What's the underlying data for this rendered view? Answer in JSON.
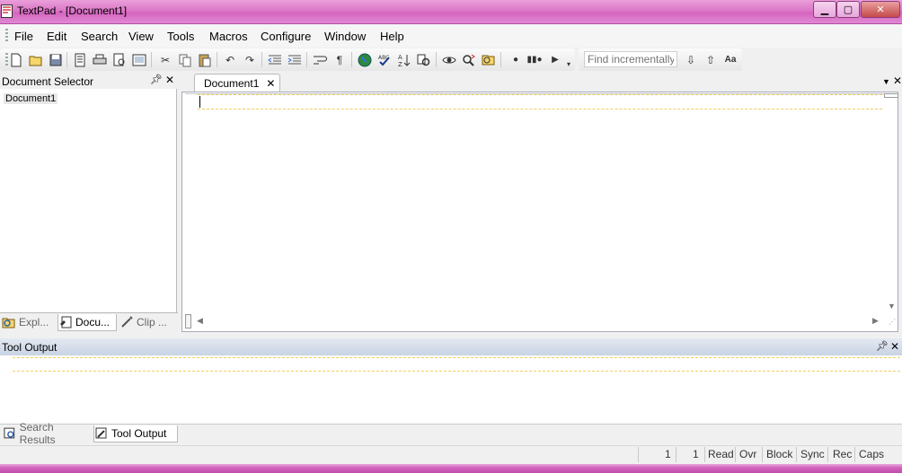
{
  "window": {
    "title": "TextPad - [Document1]",
    "accent_color": "#dc77c8",
    "caption_buttons": [
      "minimize-icon",
      "maximize-icon",
      "close-icon"
    ]
  },
  "menubar": {
    "items": [
      "File",
      "Edit",
      "Search",
      "View",
      "Tools",
      "Macros",
      "Configure",
      "Window",
      "Help"
    ]
  },
  "toolbar": {
    "icons": [
      "new-document-icon",
      "open-folder-icon",
      "save-icon",
      "save-all-icon",
      "print-icon",
      "print-preview-icon",
      "document-properties-icon",
      "cut-icon",
      "copy-icon",
      "paste-icon",
      "undo-icon",
      "redo-icon",
      "decrease-indent-icon",
      "increase-indent-icon",
      "word-wrap-icon",
      "paragraph-marks-icon",
      "browser-globe-icon",
      "spell-check-icon",
      "sort-icon",
      "compare-files-icon",
      "find-icon",
      "replace-icon",
      "find-in-files-icon",
      "record-macro-icon",
      "pause-macro-icon",
      "play-macro-icon"
    ],
    "find": {
      "placeholder": "Find incrementally",
      "down_icon": "arrow-down-icon",
      "up_icon": "arrow-up-icon",
      "case_label": "Aa"
    }
  },
  "document_selector": {
    "title": "Document Selector",
    "documents": [
      "Document1"
    ],
    "tabs": [
      {
        "label": "Expl...",
        "icon": "explorer-icon"
      },
      {
        "label": "Docu...",
        "icon": "document-icon"
      },
      {
        "label": "Clip ...",
        "icon": "clip-icon"
      }
    ]
  },
  "editor": {
    "tab_label": "Document1",
    "content": ""
  },
  "tool_output": {
    "title": "Tool Output",
    "tabs": [
      {
        "label": "Search Results",
        "icon": "search-results-icon"
      },
      {
        "label": "Tool Output",
        "icon": "tool-output-icon"
      }
    ]
  },
  "statusbar": {
    "line": "1",
    "column": "1",
    "flags": [
      "Read",
      "Ovr",
      "Block",
      "Sync",
      "Rec",
      "Caps"
    ]
  }
}
